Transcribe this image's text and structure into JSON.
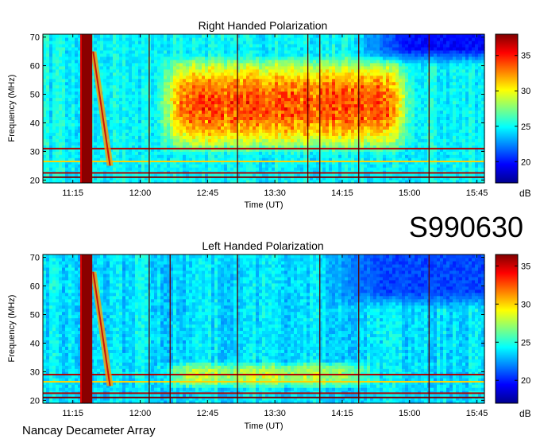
{
  "figure": {
    "session_code": "S990630",
    "instrument": "Nancay Decameter Array"
  },
  "chart_data": [
    {
      "type": "heatmap",
      "title": "Right Handed Polarization",
      "xlabel": "Time (UT)",
      "ylabel": "Frequency (MHz)",
      "x_ticks": [
        "11:15",
        "12:00",
        "12:45",
        "13:30",
        "14:15",
        "15:00",
        "15:45"
      ],
      "y_ticks": [
        20,
        30,
        40,
        50,
        60,
        70
      ],
      "xlim": [
        "10:55",
        "15:50"
      ],
      "ylim": [
        19,
        71
      ],
      "colorbar": {
        "label": "dB",
        "range": [
          17,
          38
        ],
        "ticks": [
          20,
          25,
          30,
          35
        ]
      },
      "features": {
        "background_db": 24,
        "emission_region": {
          "t_start": "12:10",
          "t_end": "15:05",
          "f_low": 29,
          "f_high": 64,
          "peak_db": 33
        },
        "burst": {
          "t_start": "11:21",
          "t_end": "11:28",
          "f_low": 19,
          "f_high": 71
        },
        "drift_band": {
          "t_start": "11:27",
          "t_end": "11:42",
          "f_high": 65,
          "f_low": 25
        },
        "interference_lines_mhz": [
          21,
          22.5,
          26.5,
          31
        ],
        "vertical_lines": [
          "12:06",
          "13:05",
          "13:52",
          "14:00",
          "14:26",
          "15:13"
        ],
        "quiet_corner": {
          "t_start": "14:20",
          "f_low": 60,
          "db": 19
        }
      }
    },
    {
      "type": "heatmap",
      "title": "Left Handed Polarization",
      "xlabel": "Time (UT)",
      "ylabel": "Frequency (MHz)",
      "x_ticks": [
        "11:15",
        "12:00",
        "12:45",
        "13:30",
        "14:15",
        "15:00",
        "15:45"
      ],
      "y_ticks": [
        20,
        30,
        40,
        50,
        60,
        70
      ],
      "xlim": [
        "10:55",
        "15:50"
      ],
      "ylim": [
        19,
        71
      ],
      "colorbar": {
        "label": "dB",
        "range": [
          17,
          36.5
        ],
        "ticks": [
          20,
          25,
          30,
          35
        ]
      },
      "features": {
        "background_db": 23,
        "emission_region": {
          "t_start": "12:10",
          "t_end": "14:40",
          "f_low": 24,
          "f_high": 34,
          "peak_db": 27
        },
        "burst": {
          "t_start": "11:21",
          "t_end": "11:28",
          "f_low": 19,
          "f_high": 71
        },
        "drift_band": {
          "t_start": "11:27",
          "t_end": "11:42",
          "f_high": 65,
          "f_low": 25
        },
        "interference_lines_mhz": [
          21,
          22.5,
          26.5,
          29
        ],
        "vertical_lines": [
          "12:06",
          "12:20",
          "13:05",
          "14:00",
          "14:26",
          "15:13"
        ],
        "quiet_corner": {
          "t_start": "14:00",
          "f_low": 52,
          "db": 20
        }
      }
    }
  ]
}
